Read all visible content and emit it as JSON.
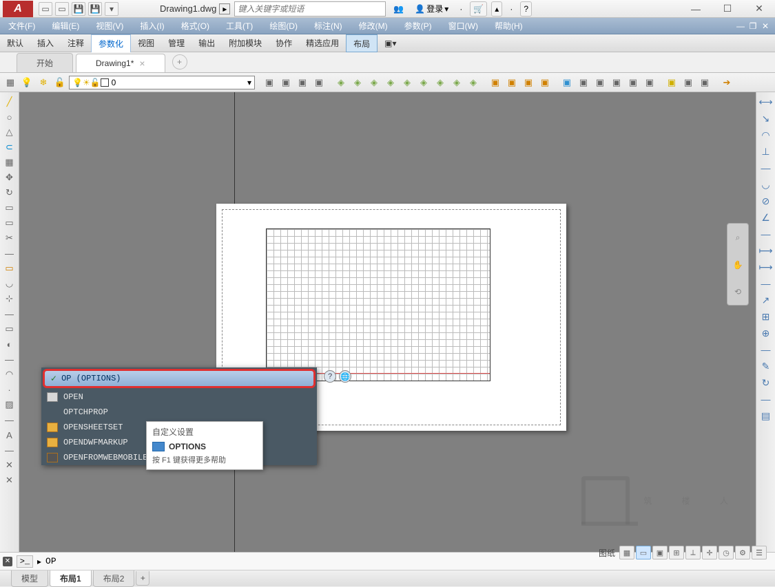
{
  "title": {
    "appInitial": "A",
    "document": "Drawing1.dwg",
    "searchPlaceholder": "键入关键字或短语",
    "login": "登录"
  },
  "menu": {
    "items": [
      "文件(F)",
      "编辑(E)",
      "视图(V)",
      "插入(I)",
      "格式(O)",
      "工具(T)",
      "绘图(D)",
      "标注(N)",
      "修改(M)",
      "参数(P)",
      "窗口(W)",
      "帮助(H)"
    ]
  },
  "ribbon": {
    "items": [
      "默认",
      "插入",
      "注释",
      "参数化",
      "视图",
      "管理",
      "输出",
      "附加模块",
      "协作",
      "精选应用",
      "布局"
    ],
    "active": "参数化",
    "layout": "布局"
  },
  "fileTabs": {
    "start": "开始",
    "active": "Drawing1*"
  },
  "layerDropdown": {
    "value": "0"
  },
  "autocomplete": {
    "highlighted": "OP (OPTIONS)",
    "items": [
      "OPEN",
      "OPTCHPROP",
      "OPENSHEETSET",
      "OPENDWFMARKUP",
      "OPENFROMWEBMOBILE"
    ],
    "tooltip": {
      "header": "自定义设置",
      "main": "OPTIONS",
      "f1": "按 F1 键获得更多帮助"
    }
  },
  "commandLine": {
    "value": "OP"
  },
  "layoutTabs": {
    "items": [
      "模型",
      "布局1",
      "布局2"
    ],
    "active": "布局1"
  },
  "statusbar": {
    "label": "图纸"
  },
  "watermark": "筑 楼 人"
}
